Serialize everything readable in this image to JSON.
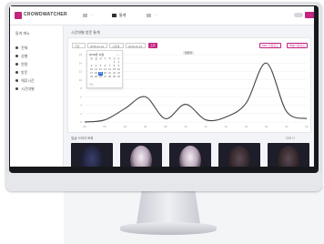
{
  "app": {
    "logo": "CROWDWATCHER",
    "nav": [
      {
        "label": "···",
        "icon": "monitor-icon",
        "active": false
      },
      {
        "label": "통계",
        "icon": "bar-chart-icon",
        "active": true
      },
      {
        "label": "···",
        "icon": "cloud-icon",
        "active": false
      }
    ],
    "logout_label": "···",
    "accent": "#c2247f"
  },
  "sidebar": {
    "title": "통계 메뉴",
    "items": [
      {
        "label": "전체"
      },
      {
        "label": "성별"
      },
      {
        "label": "연령"
      },
      {
        "label": "방문"
      },
      {
        "label": "체류시간"
      },
      {
        "label": "시간대별"
      }
    ]
  },
  "main": {
    "section_title": "시간대별 방문 통계",
    "controls": {
      "date_label": "기간",
      "date_from": "2019-11-12",
      "time_select": "시간대별",
      "date_to": "2019-11-19",
      "search": "조회",
      "export_pdf": "PDF 다운로드",
      "export_excel": "엑셀 다운로드"
    },
    "legend": "방문자",
    "calendar": {
      "month": "2019년 11월",
      "days": [
        "일",
        "월",
        "화",
        "수",
        "목",
        "금",
        "토"
      ],
      "dates": [
        "",
        "",
        "",
        "",
        "",
        "1",
        "2",
        "3",
        "4",
        "5",
        "6",
        "7",
        "8",
        "9",
        "10",
        "11",
        "12",
        "13",
        "14",
        "15",
        "16",
        "17",
        "18",
        "19",
        "20",
        "21",
        "22",
        "23",
        "24",
        "25",
        "26",
        "27",
        "28",
        "29",
        "30"
      ],
      "selected": "19",
      "footer": "오늘"
    },
    "gallery": {
      "title": "얼굴 이미지 목록",
      "more": "더보기",
      "thumbs": [
        {
          "tone": "dark"
        },
        {
          "tone": "light"
        },
        {
          "tone": "light"
        },
        {
          "tone": "dim"
        },
        {
          "tone": "dim"
        }
      ]
    }
  },
  "chart_data": {
    "type": "line",
    "x": [
      "00",
      "02",
      "04",
      "06",
      "08",
      "10",
      "12",
      "14",
      "16",
      "18",
      "20",
      "22"
    ],
    "series": [
      {
        "name": "방문자",
        "values": [
          0,
          0.5,
          3.2,
          6,
          0.8,
          4.2,
          0.5,
          1.2,
          4.5,
          14,
          2.5,
          0.8
        ]
      }
    ],
    "ylim": [
      0,
      16
    ],
    "yticks": [
      "0",
      "2",
      "4",
      "6",
      "8",
      "10",
      "12",
      "14",
      "16"
    ],
    "grid": true,
    "color": "#444444"
  }
}
